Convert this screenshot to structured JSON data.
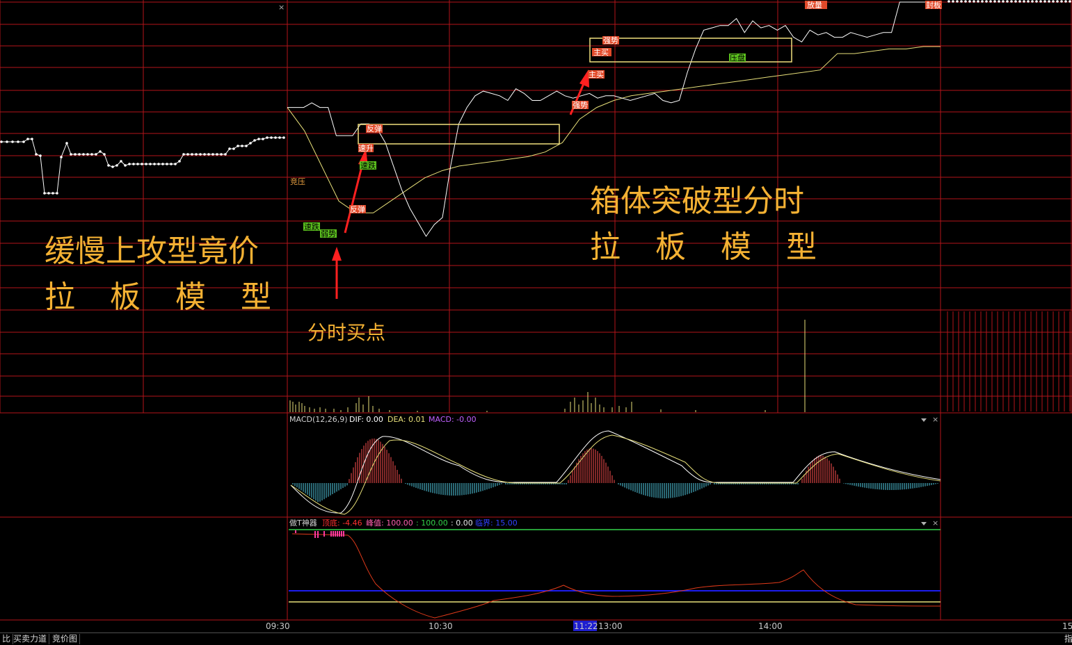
{
  "overlay_text": {
    "left_line1": "缓慢上攻型竟价",
    "left_line2": "拉 板 模 型",
    "right_line1": "箱体突破型分时",
    "right_line2": "拉 板 模 型",
    "buy_point": "分时买点"
  },
  "tags": {
    "t1": "竞压",
    "t2": "速跌",
    "t3": "弱势",
    "t4": "反弹",
    "t5": "速跌",
    "t6": "速升",
    "t7": "反弹",
    "t8": "主买",
    "t9": "强势",
    "t10": "主买",
    "t11": "强势",
    "t12": "压盘",
    "t13": "放量",
    "t14": "封板"
  },
  "macd": {
    "title": "MACD(12,26,9)",
    "dif": "DIF: 0.00",
    "dea": "DEA: 0.01",
    "macd": "MACD: -0.00"
  },
  "zt": {
    "title": "做T神器",
    "dingdi": "顶底: -4.46",
    "fengzhi": "峰值: 100.00",
    "v2": ": 100.00",
    "v3": ": 0.00",
    "linjie": "临界: 15.00"
  },
  "time_axis": {
    "t0930": "09:30",
    "t1030": "10:30",
    "t1122": "11:22",
    "t1300": "13:00",
    "t1400": "14:00",
    "t15": "15"
  },
  "tabs": {
    "tab1": "比",
    "tab2": "买卖力道",
    "tab3": "竞价图",
    "right": "指"
  },
  "close_glyph": "×",
  "colors": {
    "grid_red": "#b3151a",
    "price_white": "#ffffff",
    "avg_yellow": "#e8e07a",
    "text_gold": "#f4b133",
    "box_yellow": "#f1e07e",
    "arrow_red": "#ff2020",
    "tag_red": "#e24a2a",
    "tag_green": "#5bbf1e"
  },
  "chart_data": {
    "type": "line",
    "series": [
      {
        "name": "price",
        "values": [
          0.55,
          0.55,
          0.55,
          0.57,
          0.55,
          0.55,
          0.43,
          0.43,
          0.43,
          0.48,
          0.48,
          0.46,
          0.4,
          0.3,
          0.2,
          0.12,
          0.06,
          0.0,
          0.05,
          0.08,
          0.3,
          0.48,
          0.55,
          0.6,
          0.62,
          0.61,
          0.6,
          0.58,
          0.63,
          0.61,
          0.58,
          0.58,
          0.6,
          0.62,
          0.6,
          0.59,
          0.6,
          0.61,
          0.59,
          0.6,
          0.6,
          0.59,
          0.58,
          0.59,
          0.6,
          0.61,
          0.58,
          0.57,
          0.58,
          0.7,
          0.8,
          0.88,
          0.89,
          0.9,
          0.9,
          0.93,
          0.87,
          0.92,
          0.89,
          0.9,
          0.88,
          0.9,
          0.85,
          0.83,
          0.88,
          0.86,
          0.87,
          0.85,
          0.85,
          0.87,
          0.86,
          0.85,
          0.86,
          0.87,
          0.87,
          1.0,
          1.0,
          1.0,
          1.0,
          1.0,
          1.0
        ]
      },
      {
        "name": "average",
        "values": [
          0.55,
          0.45,
          0.3,
          0.15,
          0.1,
          0.1,
          0.15,
          0.2,
          0.25,
          0.28,
          0.3,
          0.31,
          0.32,
          0.33,
          0.34,
          0.36,
          0.4,
          0.5,
          0.55,
          0.58,
          0.6,
          0.61,
          0.62,
          0.63,
          0.64,
          0.65,
          0.66,
          0.67,
          0.68,
          0.69,
          0.7,
          0.71,
          0.78,
          0.78,
          0.79,
          0.8,
          0.8,
          0.81,
          0.81
        ]
      }
    ]
  }
}
